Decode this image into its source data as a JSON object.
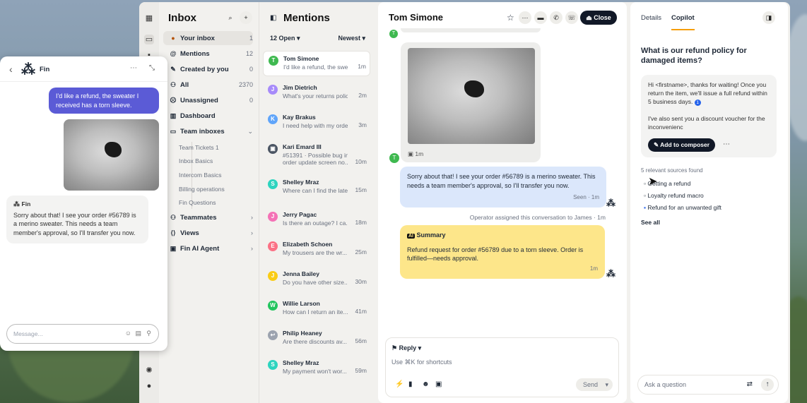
{
  "inbox": {
    "title": "Inbox",
    "nav": [
      {
        "label": "Your inbox",
        "count": "1",
        "icon": "avatar"
      },
      {
        "label": "Mentions",
        "count": "12",
        "icon": "at"
      },
      {
        "label": "Created by you",
        "count": "0",
        "icon": "pen"
      },
      {
        "label": "All",
        "count": "2370",
        "icon": "people"
      },
      {
        "label": "Unassigned",
        "count": "0",
        "icon": "person-off"
      },
      {
        "label": "Dashboard",
        "count": "",
        "icon": "chart"
      },
      {
        "label": "Team inboxes",
        "count": "",
        "icon": "inbox"
      }
    ],
    "team_inboxes": [
      "Team Tickets 1",
      "Inbox Basics",
      "Intercom Basics",
      "Billing operations",
      "Fin Questions"
    ],
    "nav_bottom": [
      {
        "label": "Teammates",
        "icon": "people"
      },
      {
        "label": "Views",
        "icon": "brackets"
      },
      {
        "label": "Fin AI Agent",
        "icon": "bot"
      }
    ]
  },
  "mentions": {
    "title": "Mentions",
    "filter": "12 Open",
    "sort": "Newest",
    "items": [
      {
        "initial": "T",
        "color": "#3fb950",
        "name": "Tom Simone",
        "preview": "I'd like a refund, the swe...",
        "time": "1m"
      },
      {
        "initial": "J",
        "color": "#a78bfa",
        "name": "Jim Dietrich",
        "preview": "What's your returns polic...",
        "time": "2m"
      },
      {
        "initial": "K",
        "color": "#60a5fa",
        "name": "Kay Brakus",
        "preview": "I need help with my order",
        "time": "3m"
      },
      {
        "initial": "▣",
        "color": "#4b5563",
        "name": "Kari Emard III",
        "preview": "#51391 · Possible bug in",
        "preview2": "order update screen no...",
        "time": "10m"
      },
      {
        "initial": "S",
        "color": "#2dd4bf",
        "name": "Shelley Mraz",
        "preview": "Where can I find the late",
        "time": "15m"
      },
      {
        "initial": "J",
        "color": "#f472b6",
        "name": "Jerry Pagac",
        "preview": "Is there an outage? I ca...",
        "time": "18m"
      },
      {
        "initial": "E",
        "color": "#fb7185",
        "name": "Elizabeth Schoen",
        "preview": "My trousers are the wr...",
        "time": "25m"
      },
      {
        "initial": "J",
        "color": "#facc15",
        "name": "Jenna Bailey",
        "preview": "Do you have other size...",
        "time": "30m"
      },
      {
        "initial": "W",
        "color": "#22c55e",
        "name": "Willie Larson",
        "preview": "How can I return an ite...",
        "time": "41m"
      },
      {
        "initial": "↩",
        "color": "#9ca3af",
        "name": "Philip Heaney",
        "preview": "Are there discounts av...",
        "time": "56m"
      },
      {
        "initial": "S",
        "color": "#2dd4bf",
        "name": "Shelley Mraz",
        "preview": "My payment won't wor...",
        "time": "59m"
      }
    ]
  },
  "conversation": {
    "title": "Tom Simone",
    "close_label": "Close",
    "image_time": "1m",
    "reply_text": "Sorry about that! I see your order #56789 is a merino sweater. This needs a team member's approval, so I'll transfer you now.",
    "reply_meta": "Seen · 1m",
    "event": "Operator assigned this conversation to James · 1m",
    "summary_label": "Summary",
    "summary_text": "Refund request for order #56789 due to a torn sleeve. Order is fulfilled—needs approval.",
    "summary_time": "1m",
    "composer_mode": "Reply",
    "composer_placeholder": "Use ⌘K for shortcuts",
    "send_label": "Send"
  },
  "copilot": {
    "tabs": [
      "Details",
      "Copilot"
    ],
    "question": "What is our refund policy for damaged items?",
    "answer_p1": "Hi <firstname>, thanks for waiting! Once you return the item, we'll issue a full refund within 5 business days.",
    "answer_ref": "1",
    "answer_p2": "I've also sent you a discount voucher for the inconvenienc",
    "add_label": "Add to composer",
    "sources_label": "5 relevant sources found",
    "sources": [
      "Getting a refund",
      "Loyalty refund macro",
      "Refund for an unwanted gift"
    ],
    "see_all": "See all",
    "ask_placeholder": "Ask a question"
  },
  "fin": {
    "title": "Fin",
    "user_msg": "I'd like a refund, the sweater I received has a torn sleeve.",
    "bot_name": "Fin",
    "bot_msg": "Sorry about that! I see your order #56789 is a merino sweater. This needs a team member's approval, so I'll transfer you now.",
    "input_placeholder": "Message..."
  },
  "colors": {
    "accent": "#5b5bd6",
    "summary": "#fde68a",
    "reply": "#dbe7fb",
    "close_btn": "#111827"
  }
}
